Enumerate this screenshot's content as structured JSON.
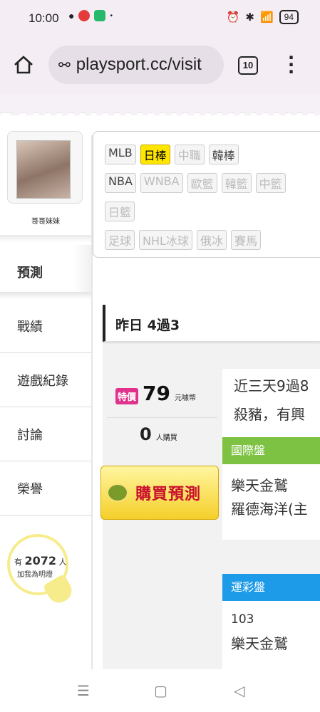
{
  "status_bar": {
    "time": "10:00",
    "battery": "94",
    "network": "4G"
  },
  "browser": {
    "url": "playsport.cc/visit",
    "tab_count": "10"
  },
  "profile": {
    "username": "哥哥妹妹"
  },
  "nav": {
    "items": [
      {
        "label": "預測"
      },
      {
        "label": "戰績"
      },
      {
        "label": "遊戲紀錄"
      },
      {
        "label": "討論"
      },
      {
        "label": "榮譽"
      }
    ]
  },
  "fans": {
    "prefix": "有",
    "count": "2072",
    "suffix": "人",
    "sub": "加我為明燈"
  },
  "tags": {
    "row1": [
      "MLB",
      "日棒",
      "中職",
      "韓棒"
    ],
    "row2": [
      "NBA",
      "WNBA",
      "歐籃",
      "韓籃",
      "中籃"
    ],
    "row3": [
      "日籃"
    ],
    "row4": [
      "足球",
      "NHL冰球",
      "俄冰",
      "賽馬"
    ]
  },
  "record": {
    "text": "昨日 4過3"
  },
  "price": {
    "badge": "特價",
    "amount": "79",
    "unit": "元噱幣"
  },
  "buyers": {
    "count": "0",
    "unit": "人購買"
  },
  "buy_button": {
    "label": "購買預測"
  },
  "description": {
    "line1": "近三天9過8",
    "line2": "殺豬，有興"
  },
  "international": {
    "header": "國際盤",
    "line1": "樂天金鷲",
    "line2": "羅德海洋(主"
  },
  "sports_lottery": {
    "header": "運彩盤",
    "line1": "103",
    "line2": "樂天金鷲"
  },
  "colors": {
    "international_header": "#7dc242",
    "lottery_header": "#1e9be8",
    "highlight_tag": "#ffe600",
    "price_badge": "#e0328a"
  }
}
